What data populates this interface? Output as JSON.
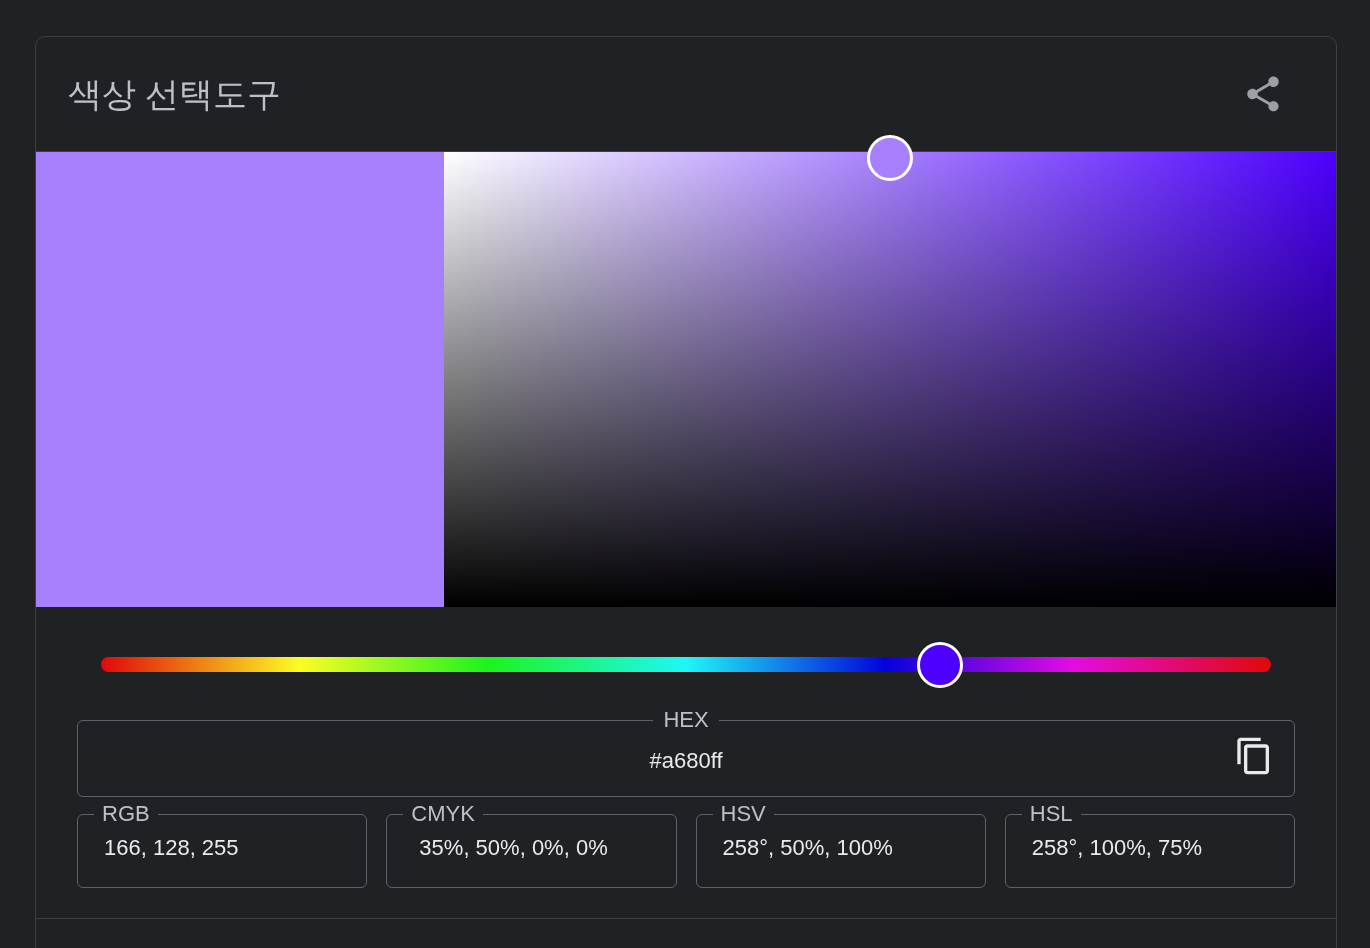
{
  "title": "색상 선택도구",
  "picker": {
    "saturation": {
      "level": 0.5
    }
  },
  "hue_slider": {
    "level": 0.717
  },
  "hex": {
    "label": "HEX",
    "value": "#a680ff"
  },
  "formats": [
    {
      "label": "RGB",
      "value": "166, 128, 255"
    },
    {
      "label": "CMYK",
      "value": " 35%, 50%, 0%, 0%"
    },
    {
      "label": "HSV",
      "value": "258°, 50%, 100%"
    },
    {
      "label": "HSL",
      "value": "258°, 100%, 75%"
    }
  ]
}
